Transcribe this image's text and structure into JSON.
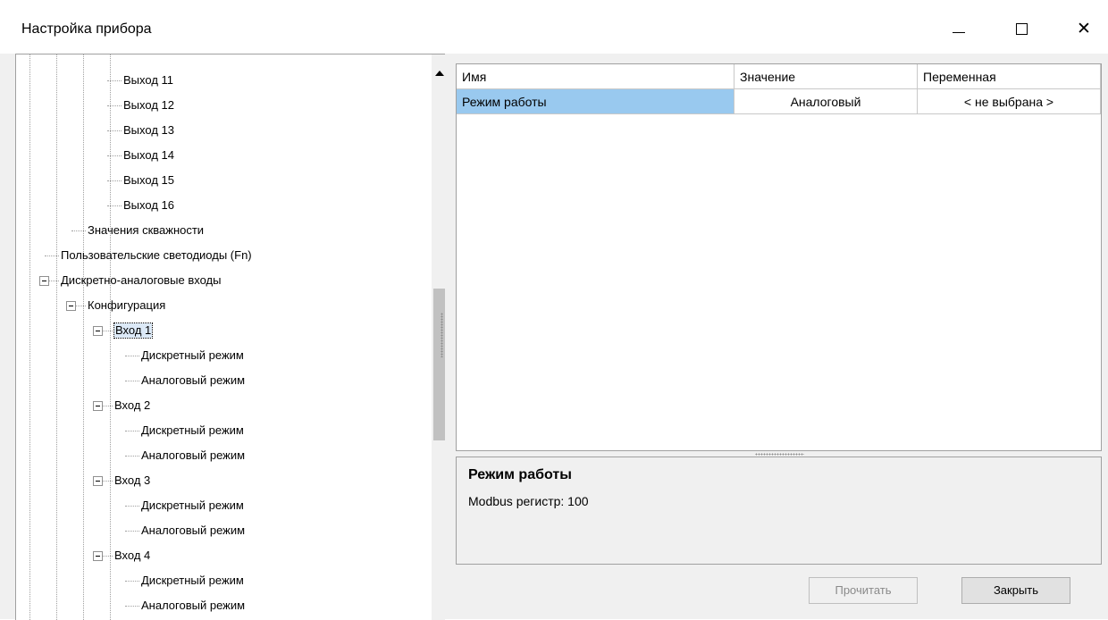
{
  "window": {
    "title": "Настройка прибора",
    "controls": {
      "minimize": "—",
      "maximize": "□",
      "close": "✕"
    }
  },
  "tree": {
    "items": [
      {
        "label": "Выход 11",
        "expanded": null
      },
      {
        "label": "Выход 12",
        "expanded": null
      },
      {
        "label": "Выход 13",
        "expanded": null
      },
      {
        "label": "Выход 14",
        "expanded": null
      },
      {
        "label": "Выход 15",
        "expanded": null
      },
      {
        "label": "Выход 16",
        "expanded": null
      },
      {
        "label": "Значения скважности",
        "expanded": null
      },
      {
        "label": "Пользовательские светодиоды (Fn)",
        "expanded": null
      },
      {
        "label": "Дискретно-аналоговые входы",
        "expanded": true
      },
      {
        "label": "Конфигурация",
        "expanded": true
      },
      {
        "label": "Вход 1",
        "expanded": true,
        "selected": true
      },
      {
        "label": "Дискретный режим",
        "expanded": null
      },
      {
        "label": "Аналоговый режим",
        "expanded": null
      },
      {
        "label": "Вход 2",
        "expanded": true
      },
      {
        "label": "Дискретный режим",
        "expanded": null
      },
      {
        "label": "Аналоговый режим",
        "expanded": null
      },
      {
        "label": "Вход 3",
        "expanded": true
      },
      {
        "label": "Дискретный режим",
        "expanded": null
      },
      {
        "label": "Аналоговый режим",
        "expanded": null
      },
      {
        "label": "Вход 4",
        "expanded": true
      },
      {
        "label": "Дискретный режим",
        "expanded": null
      },
      {
        "label": "Аналоговый режим",
        "expanded": null
      }
    ],
    "scrollbar": {
      "up_icon": "scroll-up-arrow-icon",
      "down_icon": "scroll-down-arrow-icon"
    }
  },
  "grid": {
    "columns": [
      "Имя",
      "Значение",
      "Переменная"
    ],
    "rows": [
      {
        "name": "Режим работы",
        "value": "Аналоговый",
        "variable": "< не выбрана >",
        "selected": true
      }
    ],
    "selection_color": "#99c9ef"
  },
  "description": {
    "title": "Режим работы",
    "text": "Modbus регистр: 100"
  },
  "buttons": {
    "read": {
      "label": "Прочитать",
      "enabled": false
    },
    "close": {
      "label": "Закрыть",
      "enabled": true
    }
  }
}
